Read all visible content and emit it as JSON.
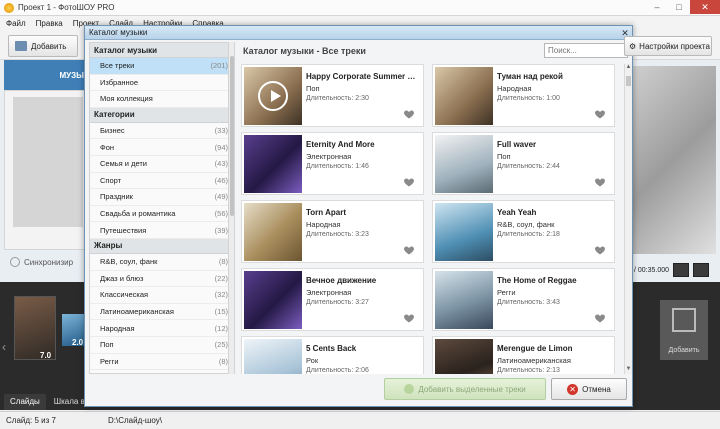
{
  "app": {
    "title": "Проект 1 - ФотоШОУ PRO",
    "menu": [
      "Файл",
      "Правка",
      "Проект",
      "Слайд",
      "Настройки",
      "Справка"
    ],
    "add_button": "Добавить",
    "settings_button": "Настройки проекта",
    "left_tab": "МУЗЫ",
    "sync_label": "Синхронизир",
    "time": "/ 00:35.000",
    "slide1_duration": "7.0",
    "slide2_duration": "2.0",
    "add_slide": "Добавить",
    "bottom_tabs": [
      "Слайды",
      "Шкала време"
    ],
    "status_left": "Слайд: 5 из 7",
    "status_path": "D:\\Слайд-шоу\\"
  },
  "dialog": {
    "title": "Каталог музыки",
    "close_glyph": "✕",
    "header": "Каталог музыки - Все треки",
    "search_placeholder": "Поиск...",
    "sections": [
      {
        "name": "Каталог музыки",
        "items": [
          {
            "label": "Все треки",
            "count": "(201)",
            "selected": true
          },
          {
            "label": "Избранное",
            "count": ""
          },
          {
            "label": "Моя коллекция",
            "count": ""
          }
        ]
      },
      {
        "name": "Категории",
        "items": [
          {
            "label": "Бизнес",
            "count": "(33)"
          },
          {
            "label": "Фон",
            "count": "(94)"
          },
          {
            "label": "Семья и дети",
            "count": "(43)"
          },
          {
            "label": "Спорт",
            "count": "(46)"
          },
          {
            "label": "Праздник",
            "count": "(49)"
          },
          {
            "label": "Свадьба и романтика",
            "count": "(56)"
          },
          {
            "label": "Путешествия",
            "count": "(39)"
          }
        ]
      },
      {
        "name": "Жанры",
        "items": [
          {
            "label": "R&B, соул, фанк",
            "count": "(8)"
          },
          {
            "label": "Джаз и блюз",
            "count": "(22)"
          },
          {
            "label": "Классическая",
            "count": "(32)"
          },
          {
            "label": "Латиноамериканская",
            "count": "(15)"
          },
          {
            "label": "Народная",
            "count": "(12)"
          },
          {
            "label": "Поп",
            "count": "(25)"
          },
          {
            "label": "Регги",
            "count": "(8)"
          }
        ]
      }
    ],
    "tracks": [
      {
        "title": "Happy Corporate Summer J...",
        "genre": "Поп",
        "duration": "Длительность: 2:30",
        "art": "guitar",
        "playing": true
      },
      {
        "title": "Туман над рекой",
        "genre": "Народная",
        "duration": "Длительность: 1:00",
        "art": "guitar"
      },
      {
        "title": "Eternity And More",
        "genre": "Электронная",
        "duration": "Длительность: 1:46",
        "art": "purple"
      },
      {
        "title": "Full waver",
        "genre": "Поп",
        "duration": "Длительность: 2:44",
        "art": "skater"
      },
      {
        "title": "Torn Apart",
        "genre": "Народная",
        "duration": "Длительность: 3:23",
        "art": "harp"
      },
      {
        "title": "Yeah Yeah",
        "genre": "R&B, соул, фанк",
        "duration": "Длительность: 2:18",
        "art": "girl"
      },
      {
        "title": "Вечное движение",
        "genre": "Электронная",
        "duration": "Длительность: 3:27",
        "art": "purple"
      },
      {
        "title": "The Home of Reggae",
        "genre": "Регги",
        "duration": "Длительность: 3:43",
        "art": "street"
      },
      {
        "title": "5 Cents Back",
        "genre": "Рок",
        "duration": "Длительность: 2:06",
        "art": "sky"
      },
      {
        "title": "Merengue de Limon",
        "genre": "Латиноамериканская",
        "duration": "Длительность: 2:13",
        "art": "band"
      }
    ],
    "add_selected_button": "Добавить выделенные треки",
    "cancel_button": "Отмена",
    "colors": {
      "selected_bg": "#bfe0f6",
      "accent": "#3f7fb6",
      "cancel_icon": "#d1352b"
    }
  }
}
